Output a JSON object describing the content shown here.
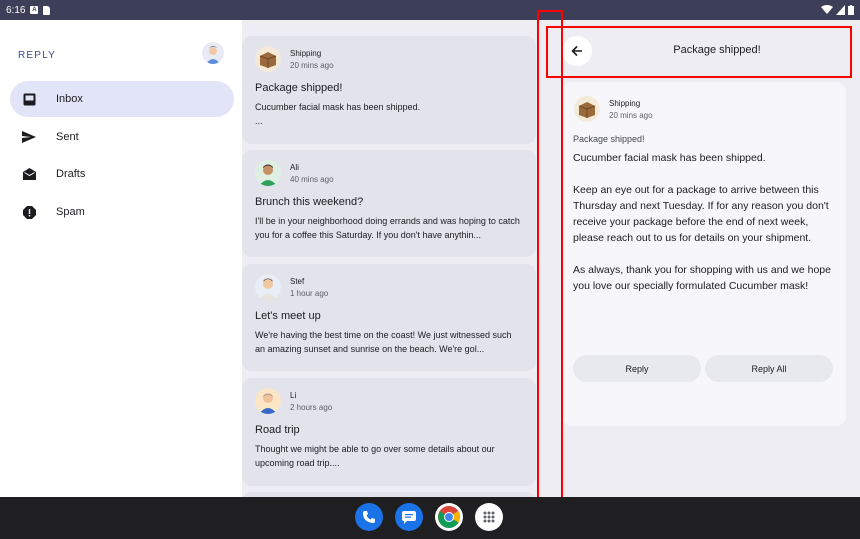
{
  "status_bar": {
    "time": "6:16",
    "badge": "A"
  },
  "nav": {
    "brand": "REPLY",
    "items": [
      {
        "label": "Inbox",
        "icon": "inbox-icon",
        "active": true
      },
      {
        "label": "Sent",
        "icon": "send-icon",
        "active": false
      },
      {
        "label": "Drafts",
        "icon": "drafts-icon",
        "active": false
      },
      {
        "label": "Spam",
        "icon": "spam-icon",
        "active": false
      }
    ]
  },
  "emails": [
    {
      "sender": "Shipping",
      "time": "20 mins ago",
      "subject": "Package shipped!",
      "preview": "Cucumber facial mask has been shipped.\n..."
    },
    {
      "sender": "Ali",
      "time": "40 mins ago",
      "subject": "Brunch this weekend?",
      "preview": "I'll be in your neighborhood doing errands and was hoping to catch you for a coffee this Saturday. If you don't have anythin..."
    },
    {
      "sender": "Stef",
      "time": "1 hour ago",
      "subject": "Let's meet up",
      "preview": "We're having the best time on the coast! We just witnessed such an amazing sunset and sunrise on the beach. We're gol..."
    },
    {
      "sender": "Li",
      "time": "2 hours ago",
      "subject": "Road trip",
      "preview": "Thought we might be able to go over some details about our upcoming road trip...."
    }
  ],
  "detail": {
    "title": "Package shipped!",
    "sender": "Shipping",
    "time": "20 mins ago",
    "subject": "Package shipped!",
    "body": "Cucumber facial mask has been shipped.\n\nKeep an eye out for a package to arrive between this Thursday and next Tuesday. If for any reason you don't receive your package before the end of next week, please reach out to us for details on your shipment.\n\nAs always, thank you for shopping with us and we hope you love our specially formulated Cucumber mask!",
    "reply_label": "Reply",
    "reply_all_label": "Reply All"
  },
  "dock": [
    "phone-icon",
    "messages-icon",
    "chrome-icon",
    "apps-icon"
  ],
  "colors": {
    "accent": "#3c4a8a",
    "active_nav": "#e2e5f7",
    "highlight": "#ff0000"
  }
}
